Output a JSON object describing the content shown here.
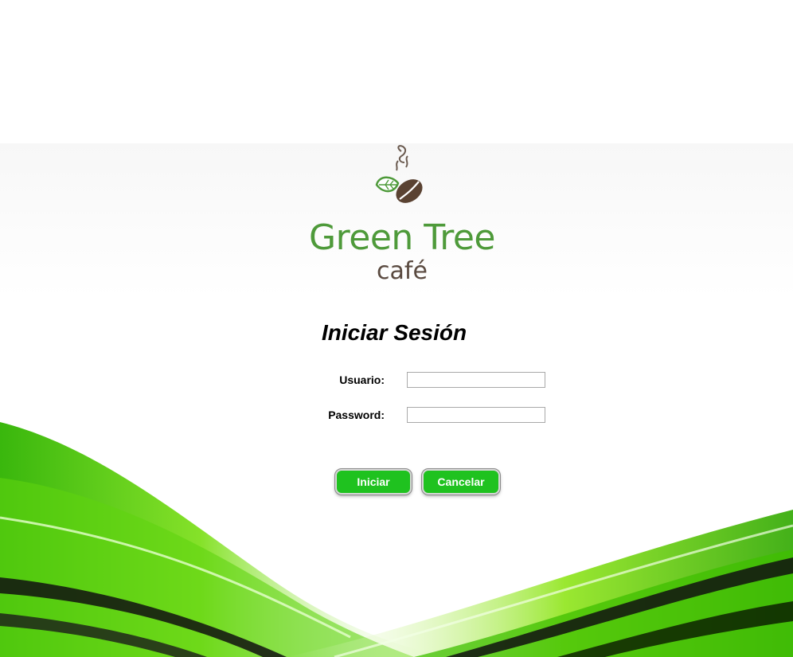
{
  "brand": {
    "name": "Green Tree",
    "sub": "café",
    "icon": "coffee-bean-leaf-logo",
    "name_color": "#4e9a3a",
    "sub_color": "#5a4a40"
  },
  "login": {
    "title": "Iniciar Sesión",
    "username_label": "Usuario:",
    "username_value": "",
    "password_label": "Password:",
    "password_value": "",
    "submit_label": "Iniciar",
    "cancel_label": "Cancelar"
  },
  "colors": {
    "button": "#1fc21f",
    "accent_green": "#4fd11f"
  }
}
